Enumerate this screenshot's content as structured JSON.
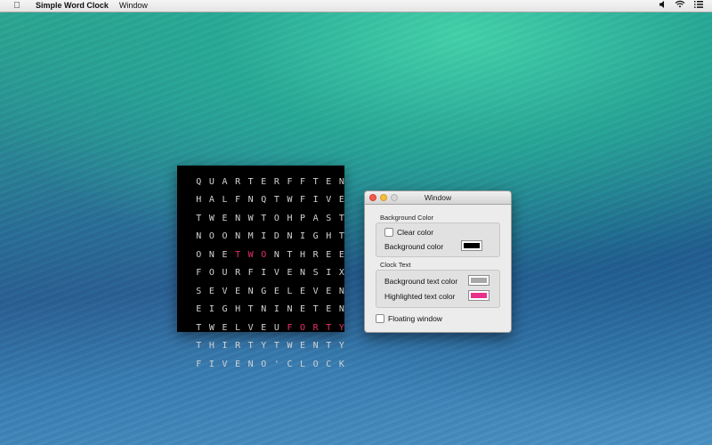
{
  "menubar": {
    "app_name": "Simple Word Clock",
    "menus": [
      "Window"
    ],
    "status_icons": [
      "volume-icon",
      "wifi-icon",
      "list-icon"
    ]
  },
  "word_clock": {
    "rows": [
      "QUARTERFFTEN",
      "HALFNQTWFIVE",
      "TWENWTOHPAST",
      "NOONMIDNIGHT",
      "ONETWONTHREE",
      "FOURFIVENSIX",
      "SEVENGELEVEN",
      "EIGHTNINETEN",
      "TWELVEUFORTY",
      "THIRTYTWENTY",
      "FIVENO'CLOCK"
    ],
    "highlighted": [
      {
        "row": 4,
        "start": 3,
        "end": 5
      },
      {
        "row": 8,
        "start": 7,
        "end": 11
      }
    ],
    "text_color": "#d2d2d2",
    "highlight_color": "#e8306e",
    "background_color": "#000000"
  },
  "prefs_window": {
    "title": "Window",
    "background_section": {
      "label": "Background Color",
      "clear_color_label": "Clear color",
      "clear_color_checked": false,
      "background_color_label": "Background color",
      "background_color_value": "#000000"
    },
    "clock_text_section": {
      "label": "Clock Text",
      "background_text_color_label": "Background text color",
      "background_text_color_value": "#a8a8a8",
      "highlighted_text_color_label": "Highlighted text color",
      "highlighted_text_color_value": "#e8308a"
    },
    "floating_window_label": "Floating window",
    "floating_window_checked": false
  }
}
